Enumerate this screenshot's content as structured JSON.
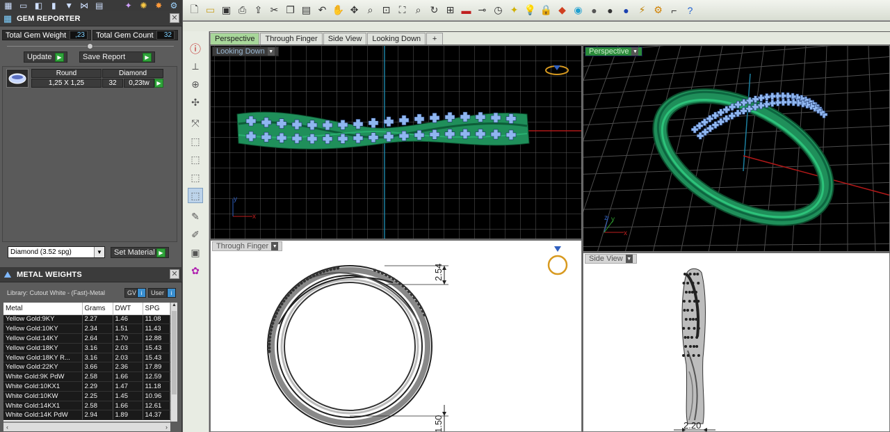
{
  "left_toolbar": {
    "icons": [
      "grid-icon",
      "monitor-icon",
      "cube-icon",
      "bar-icon",
      "funnel-icon",
      "node-icon",
      "doc-icon",
      "fx-icon",
      "layers-icon",
      "plugin-icon",
      "settings-icon"
    ]
  },
  "gem_reporter": {
    "title": "GEM REPORTER",
    "total_weight_label": "Total Gem Weight",
    "total_weight_value": ",23",
    "total_count_label": "Total Gem Count",
    "total_count_value": "32",
    "update_label": "Update",
    "save_report_label": "Save Report",
    "gem": {
      "shape": "Round",
      "type": "Diamond",
      "size": "1,25 X 1,25",
      "count": "32",
      "weight": "0,23tw"
    },
    "material_value": "Diamond    (3.52 spg)",
    "set_material_label": "Set Material"
  },
  "metal_weights": {
    "title": "METAL WEIGHTS",
    "library_label": "Library: Cutout White - (Fast)-Metal",
    "gv_label": "GV",
    "user_label": "User",
    "columns": [
      "Metal",
      "Grams",
      "DWT",
      "SPG"
    ],
    "rows": [
      [
        "Yellow Gold:9KY",
        "2.27",
        "1.46",
        "11.08"
      ],
      [
        "Yellow Gold:10KY",
        "2.34",
        "1.51",
        "11.43"
      ],
      [
        "Yellow Gold:14KY",
        "2.64",
        "1.70",
        "12.88"
      ],
      [
        "Yellow Gold:18KY",
        "3.16",
        "2.03",
        "15.43"
      ],
      [
        "Yellow Gold:18KY R...",
        "3.16",
        "2.03",
        "15.43"
      ],
      [
        "Yellow Gold:22KY",
        "3.66",
        "2.36",
        "17.89"
      ],
      [
        "White Gold:9K PdW",
        "2.58",
        "1.66",
        "12.59"
      ],
      [
        "White Gold:10KX1",
        "2.29",
        "1.47",
        "11.18"
      ],
      [
        "White Gold:10KW",
        "2.25",
        "1.45",
        "10.96"
      ],
      [
        "White Gold:14KX1",
        "2.58",
        "1.66",
        "12.61"
      ],
      [
        "White Gold:14K PdW",
        "2.94",
        "1.89",
        "14.37"
      ]
    ]
  },
  "tabs": [
    "Perspective",
    "Through Finger",
    "Side View",
    "Looking Down",
    "+"
  ],
  "active_tab": "Perspective",
  "viewports": {
    "looking_down": "Looking Down",
    "perspective": "Perspective",
    "through_finger": "Through Finger",
    "side_view": "Side View"
  },
  "dimensions": {
    "top": "2.54",
    "bottom": "1.50",
    "side": "2.20"
  },
  "axis": {
    "x": "x",
    "y": "y",
    "z": "z"
  },
  "colors": {
    "band": "#1f8f5a",
    "gem": "#8fb6f0",
    "accent_green": "#2fa33a",
    "tab_active": "#a8d79a"
  }
}
